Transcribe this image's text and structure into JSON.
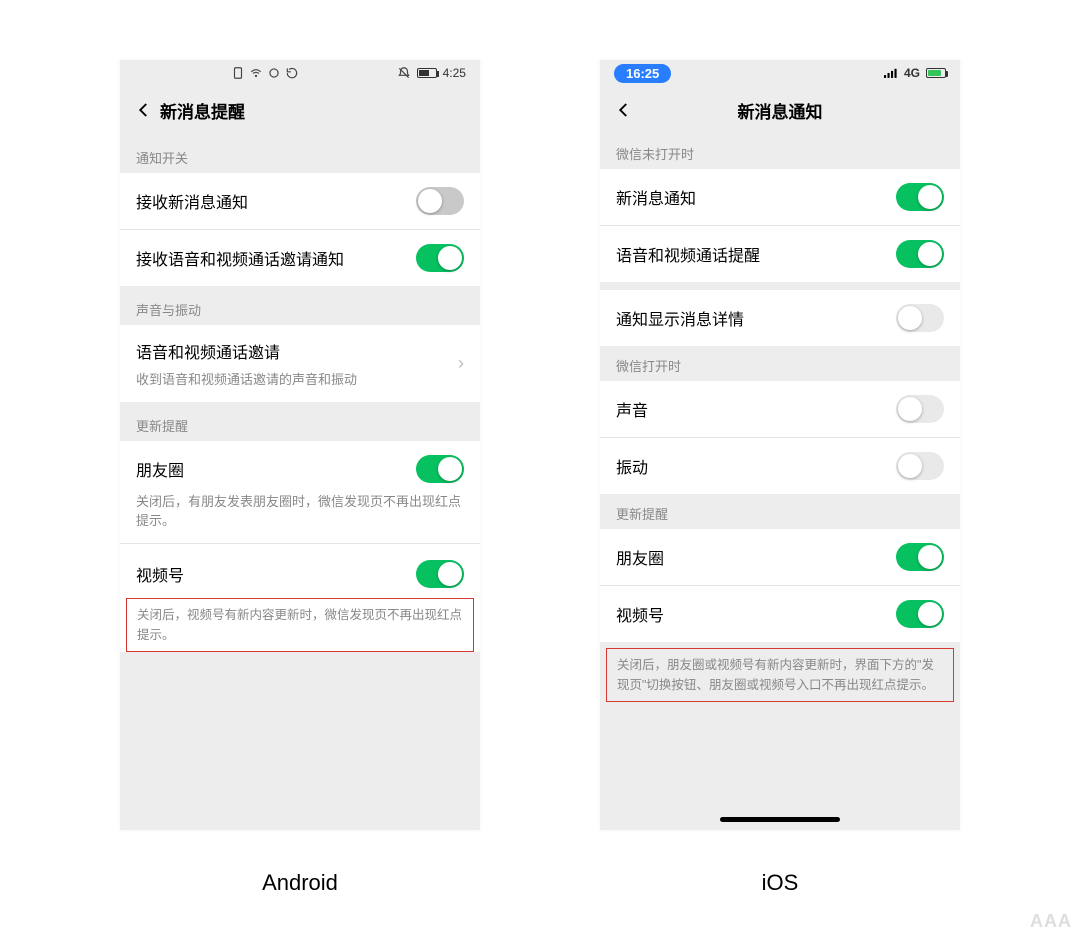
{
  "android": {
    "statusbar": {
      "time": "4:25"
    },
    "nav": {
      "title": "新消息提醒"
    },
    "section1": {
      "header": "通知开关"
    },
    "cell_receive_msg": {
      "label": "接收新消息通知",
      "on": false
    },
    "cell_receive_av": {
      "label": "接收语音和视频通话邀请通知",
      "on": true
    },
    "section2": {
      "header": "声音与振动"
    },
    "cell_av_invite": {
      "label": "语音和视频通话邀请",
      "sub": "收到语音和视频通话邀请的声音和振动"
    },
    "section3": {
      "header": "更新提醒"
    },
    "cell_moments": {
      "label": "朋友圈",
      "on": true,
      "note": "关闭后，有朋友发表朋友圈时，微信发现页不再出现红点提示。"
    },
    "cell_channels": {
      "label": "视频号",
      "on": true,
      "note": "关闭后，视频号有新内容更新时，微信发现页不再出现红点提示。"
    }
  },
  "ios": {
    "statusbar": {
      "time": "16:25",
      "net": "4G"
    },
    "nav": {
      "title": "新消息通知"
    },
    "section1": {
      "header": "微信未打开时"
    },
    "cell_msg": {
      "label": "新消息通知",
      "on": true
    },
    "cell_av": {
      "label": "语音和视频通话提醒",
      "on": true
    },
    "cell_detail": {
      "label": "通知显示消息详情",
      "on": false
    },
    "section2": {
      "header": "微信打开时"
    },
    "cell_sound": {
      "label": "声音",
      "on": false
    },
    "cell_vibrate": {
      "label": "振动",
      "on": false
    },
    "section3": {
      "header": "更新提醒"
    },
    "cell_moments": {
      "label": "朋友圈",
      "on": true
    },
    "cell_channels": {
      "label": "视频号",
      "on": true
    },
    "footer_note": "关闭后，朋友圈或视频号有新内容更新时，界面下方的\"发现页\"切换按钮、朋友圈或视频号入口不再出现红点提示。"
  },
  "captions": {
    "android": "Android",
    "ios": "iOS"
  },
  "watermark": "AAA"
}
